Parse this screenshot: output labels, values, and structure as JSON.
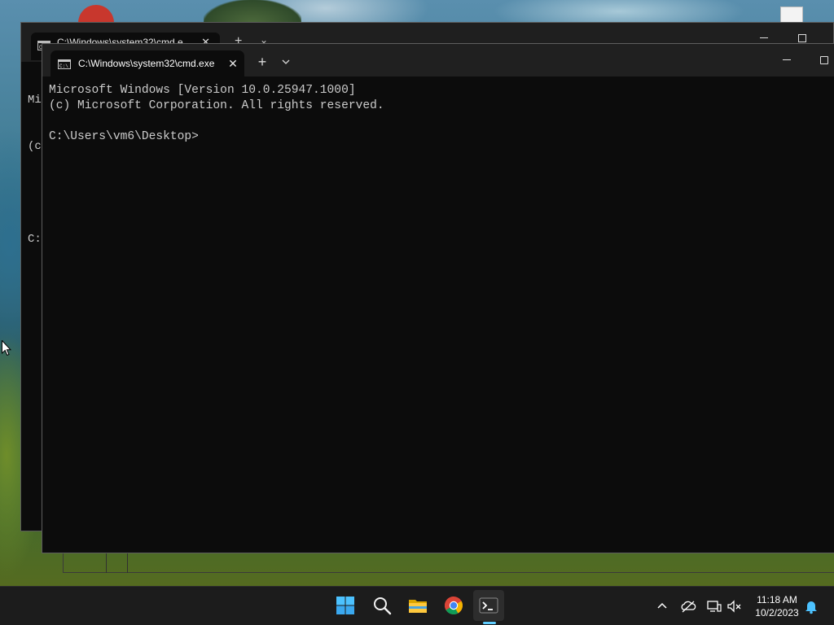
{
  "window_back": {
    "tab_title": "C:\\Windows\\system32\\cmd.e",
    "console_lines": [
      "Mi",
      "(c",
      "",
      "C:"
    ]
  },
  "window_front": {
    "tab_title": "C:\\Windows\\system32\\cmd.exe",
    "new_tab_label": "+",
    "close_label": "✕",
    "console_lines": [
      "Microsoft Windows [Version 10.0.25947.1000]",
      "(c) Microsoft Corporation. All rights reserved.",
      "",
      "C:\\Users\\vm6\\Desktop>"
    ]
  },
  "taskbar": {
    "apps": [
      "start-icon",
      "search-icon",
      "file-explorer-icon",
      "chrome-icon",
      "terminal-icon"
    ],
    "active_app": "terminal",
    "tray_icons": [
      "chevron-up-icon",
      "onedrive-icon",
      "network-icon",
      "volume-muted-icon",
      "notification-bell-icon"
    ],
    "time": "11:18 AM",
    "date": "10/2/2023"
  },
  "colors": {
    "console_bg": "#0c0c0c",
    "console_text": "#cccccc",
    "titlebar_bg": "#202020",
    "taskbar_bg": "#1c1c1c",
    "accent": "#60cdff"
  }
}
